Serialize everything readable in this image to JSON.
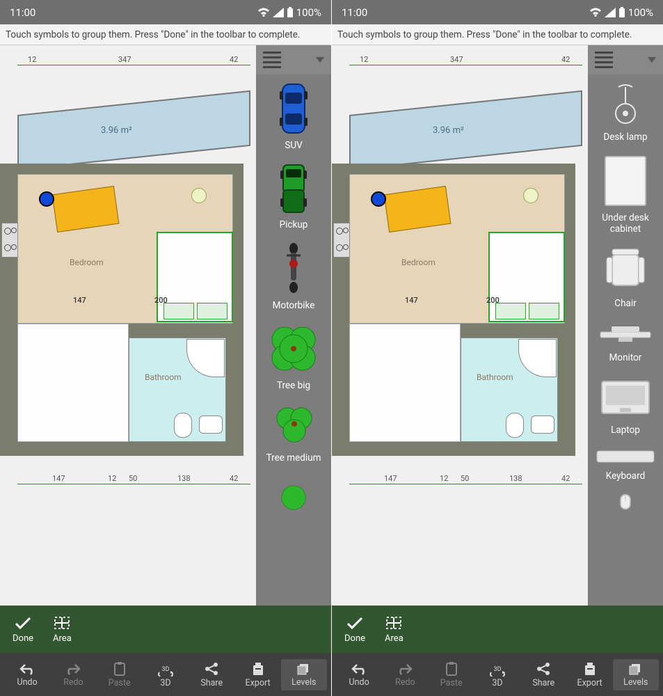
{
  "status": {
    "time": "11:00",
    "battery": "100%"
  },
  "hint": "Touch symbols to group them. Press \"Done\" in the toolbar to complete.",
  "floorplan": {
    "balcony_area": "3.96 m²",
    "rooms": {
      "bedroom": "Bedroom",
      "bathroom": "Bathroom"
    },
    "dims_top": {
      "a": "12",
      "b": "347",
      "c": "42"
    },
    "dims_mid": {
      "a": "147",
      "b": "200"
    },
    "dims_bottom": {
      "a": "147",
      "b": "12",
      "c": "50",
      "d": "138",
      "e": "42"
    }
  },
  "palette_left": [
    {
      "label": "SUV"
    },
    {
      "label": "Pickup"
    },
    {
      "label": "Motorbike"
    },
    {
      "label": "Tree big"
    },
    {
      "label": "Tree medium"
    }
  ],
  "palette_right": [
    {
      "label": "Desk lamp"
    },
    {
      "label": "Under desk cabinet"
    },
    {
      "label": "Chair"
    },
    {
      "label": "Monitor"
    },
    {
      "label": "Laptop"
    },
    {
      "label": "Keyboard"
    }
  ],
  "greenbar": {
    "done": "Done",
    "area": "Area"
  },
  "toolbar": {
    "undo": "Undo",
    "redo": "Redo",
    "paste": "Paste",
    "three_d": "3D",
    "share": "Share",
    "export": "Export",
    "levels": "Levels"
  }
}
